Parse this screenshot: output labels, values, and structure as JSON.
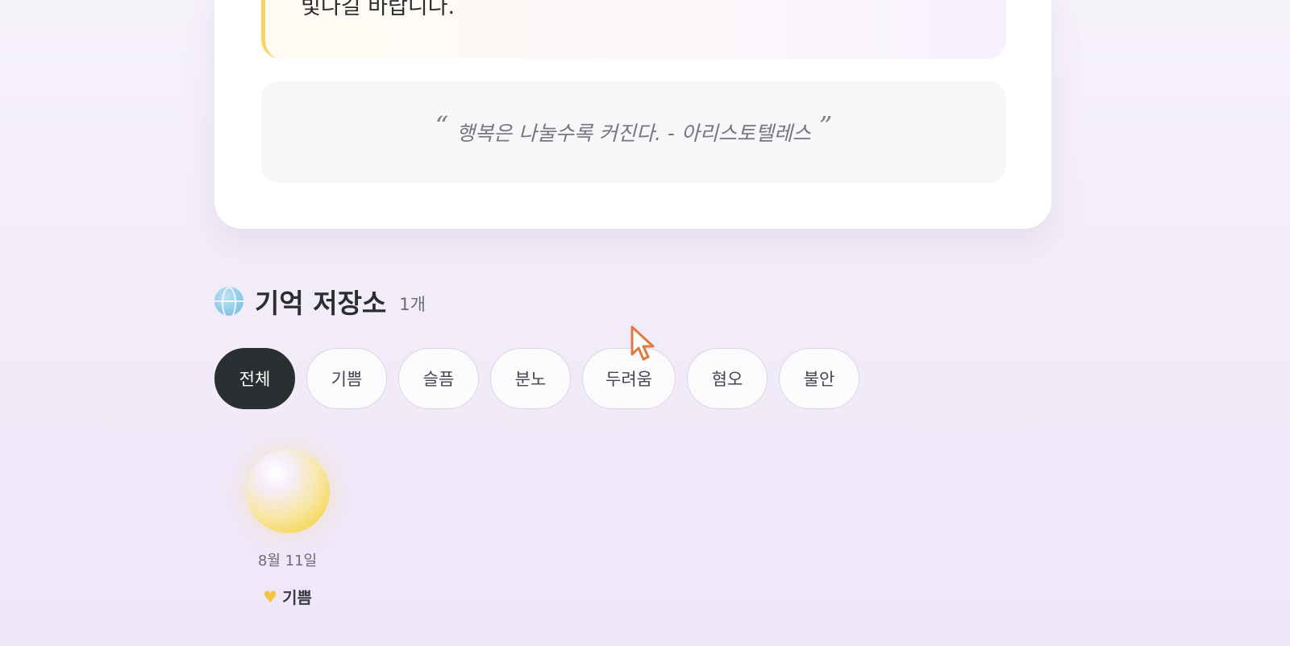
{
  "result_card": {
    "message": "빛나길 바랍니다.",
    "quote": {
      "open_mark": "“",
      "text": "행복은 나눌수록 커진다. - 아리스토텔레스",
      "close_mark": "”"
    }
  },
  "memory_section": {
    "icon": "globe-icon",
    "title": "기억 저장소",
    "count": "1개"
  },
  "filters": [
    {
      "label": "전체",
      "active": true
    },
    {
      "label": "기쁨",
      "active": false
    },
    {
      "label": "슬픔",
      "active": false
    },
    {
      "label": "분노",
      "active": false
    },
    {
      "label": "두려움",
      "active": false
    },
    {
      "label": "혐오",
      "active": false
    },
    {
      "label": "불안",
      "active": false
    }
  ],
  "memories": [
    {
      "date": "8월 11일",
      "emotion": "기쁨",
      "emotion_icon": "yellow-heart-icon",
      "color": "#f6d85d"
    }
  ],
  "colors": {
    "accent_yellow": "#f6d564",
    "active_chip": "#2a2f31",
    "cursor": "#e07a3f"
  }
}
